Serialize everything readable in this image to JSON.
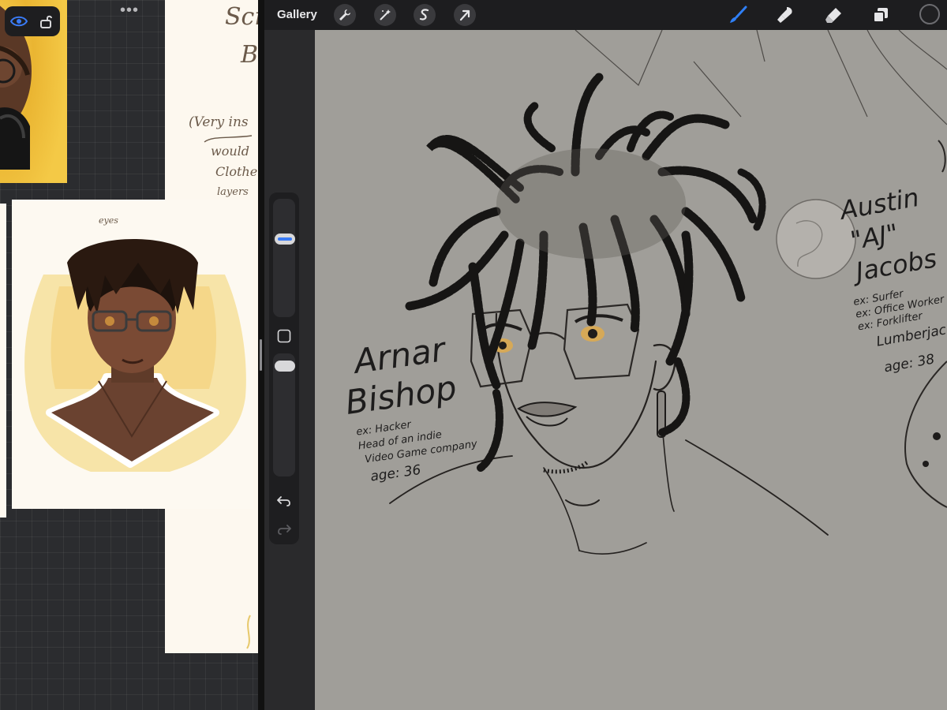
{
  "topbar": {
    "gallery_label": "Gallery",
    "left_tools": [
      "wrench-icon",
      "magic-wand-icon",
      "selection-icon",
      "transform-arrow-icon"
    ],
    "right_tools": [
      "brush-icon",
      "smudge-icon",
      "eraser-icon",
      "layers-icon",
      "color-swatch"
    ],
    "active_tool": "brush-icon",
    "accent": "#2f7ff5"
  },
  "reference_board": {
    "notes_title": "Scre",
    "notes_sub": "B",
    "notes_lines": [
      "(Very ins",
      "would",
      "Clothe",
      "layers"
    ],
    "portrait_label": "eyes"
  },
  "canvas": {
    "left_name_line1": "Arnar",
    "left_name_line2": "Bishop",
    "left_details": [
      "ex: Hacker",
      "Head of an indie",
      "Video Game company",
      "age: 36"
    ],
    "right_name_line1": "Austin",
    "right_name_line2": "\"AJ\"",
    "right_name_line3": "Jacobs",
    "right_details": [
      "ex: Surfer",
      "ex: Office Worker",
      "ex: Forklifter",
      "Lumberjack",
      "age: 38"
    ],
    "background": "#a09e99"
  },
  "sidebar": {
    "brush_size_level": 0.68,
    "opacity_level": 0.95,
    "buttons": [
      "modify-square-icon",
      "undo-icon",
      "redo-icon"
    ]
  }
}
